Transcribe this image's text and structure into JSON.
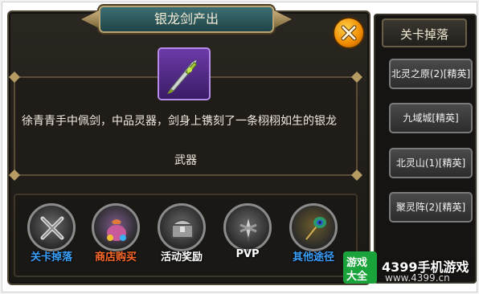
{
  "dialog": {
    "title": "银龙剑产出",
    "item_description": "徐青青手中佩剑，中品灵器，剑身上镌刻了一条栩栩如生的银龙",
    "item_type": "武器",
    "item_frame_color": "#7a3fc2"
  },
  "sources": [
    {
      "label": "关卡掉落",
      "icon": "crossed-swords-icon",
      "color": "#3aa0ff"
    },
    {
      "label": "商店购买",
      "icon": "money-bag-icon",
      "color": "#ff6a2a"
    },
    {
      "label": "活动奖励",
      "icon": "treasure-chest-icon",
      "color": "#ffffff"
    },
    {
      "label": "PVP",
      "icon": "pvp-blade-icon",
      "color": "#ffffff"
    },
    {
      "label": "其他途径",
      "icon": "peacock-feather-icon",
      "color": "#3aa0ff"
    }
  ],
  "drop_panel": {
    "header": "关卡掉落",
    "stages": [
      "北灵之原(2)[精英]",
      "九域城[精英]",
      "北灵山(1)[精英]",
      "聚灵阵(2)[精英]"
    ]
  },
  "watermark": {
    "logo_top": "游戏",
    "logo_bottom": "大全",
    "brand": "4399手机游戏",
    "url": "www.4399.cn"
  }
}
